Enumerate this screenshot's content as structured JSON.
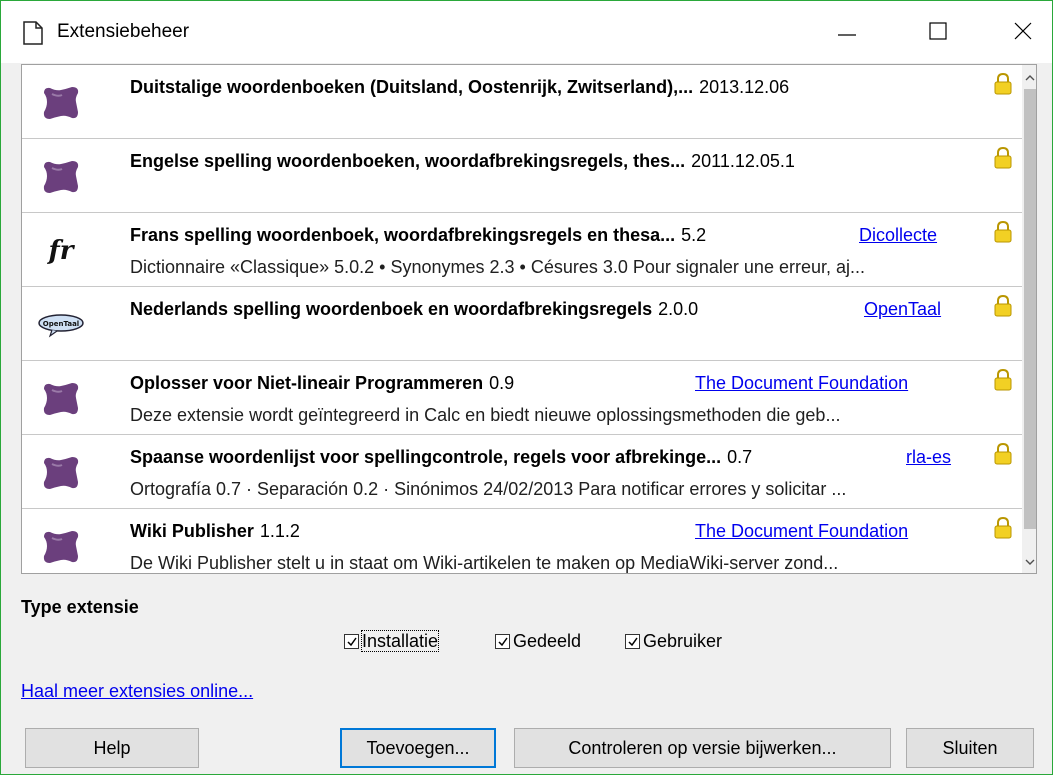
{
  "window": {
    "title": "Extensiebeheer"
  },
  "extensions": [
    {
      "name": "Duitstalige woordenboeken (Duitsland, Oostenrijk, Zwitserland),...",
      "version": "2013.12.06",
      "publisher": "",
      "description": "",
      "icon": "puzzle-piece-icon"
    },
    {
      "name": "Engelse spelling woordenboeken, woordafbrekingsregels, thes...",
      "version": "2011.12.05.1",
      "publisher": "",
      "description": "",
      "icon": "puzzle-piece-icon"
    },
    {
      "name": "Frans spelling woordenboek, woordafbrekingsregels en thesa...",
      "version": "5.2",
      "publisher": "Dicollecte",
      "description": "Dictionnaire «Classique» 5.0.2 • Synonymes 2.3 • Césures 3.0   Pour signaler une erreur, aj...",
      "icon": "fr-logo-icon",
      "icon_text": "fr"
    },
    {
      "name": "Nederlands spelling woordenboek en woordafbrekingsregels",
      "version": "2.0.0",
      "publisher": "OpenTaal",
      "description": "",
      "icon": "opentaal-logo-icon",
      "icon_text": "OpenTaal"
    },
    {
      "name": "Oplosser voor Niet-lineair Programmeren",
      "version": "0.9",
      "publisher": "The Document Foundation",
      "description": "Deze extensie wordt geïntegreerd in Calc en biedt nieuwe oplossingsmethoden die geb...",
      "icon": "puzzle-piece-icon"
    },
    {
      "name": "Spaanse woordenlijst voor spellingcontrole, regels voor afbrekinge...",
      "version": "0.7",
      "publisher": "rla-es",
      "description": "Ortografía 0.7 · Separación 0.2 · Sinónimos 24/02/2013   Para notificar errores y solicitar ...",
      "icon": "puzzle-piece-icon"
    },
    {
      "name": "Wiki Publisher",
      "version": "1.1.2",
      "publisher": "The Document Foundation",
      "description": "De Wiki Publisher stelt u in staat om Wiki-artikelen te maken op MediaWiki-server zond...",
      "icon": "puzzle-piece-icon"
    }
  ],
  "type_section": {
    "label": "Type extensie",
    "options": [
      {
        "label": "Installatie",
        "checked": true
      },
      {
        "label": "Gedeeld",
        "checked": true
      },
      {
        "label": "Gebruiker",
        "checked": true
      }
    ]
  },
  "online_link": "Haal meer extensies online...",
  "buttons": {
    "help": "Help",
    "add": "Toevoegen...",
    "check_updates": "Controleren op versie bijwerken...",
    "close": "Sluiten"
  },
  "colors": {
    "link": "#0000ee",
    "window_border": "#2aa83a",
    "puzzle": "#6b3f7d",
    "default_button_border": "#0078d7"
  }
}
